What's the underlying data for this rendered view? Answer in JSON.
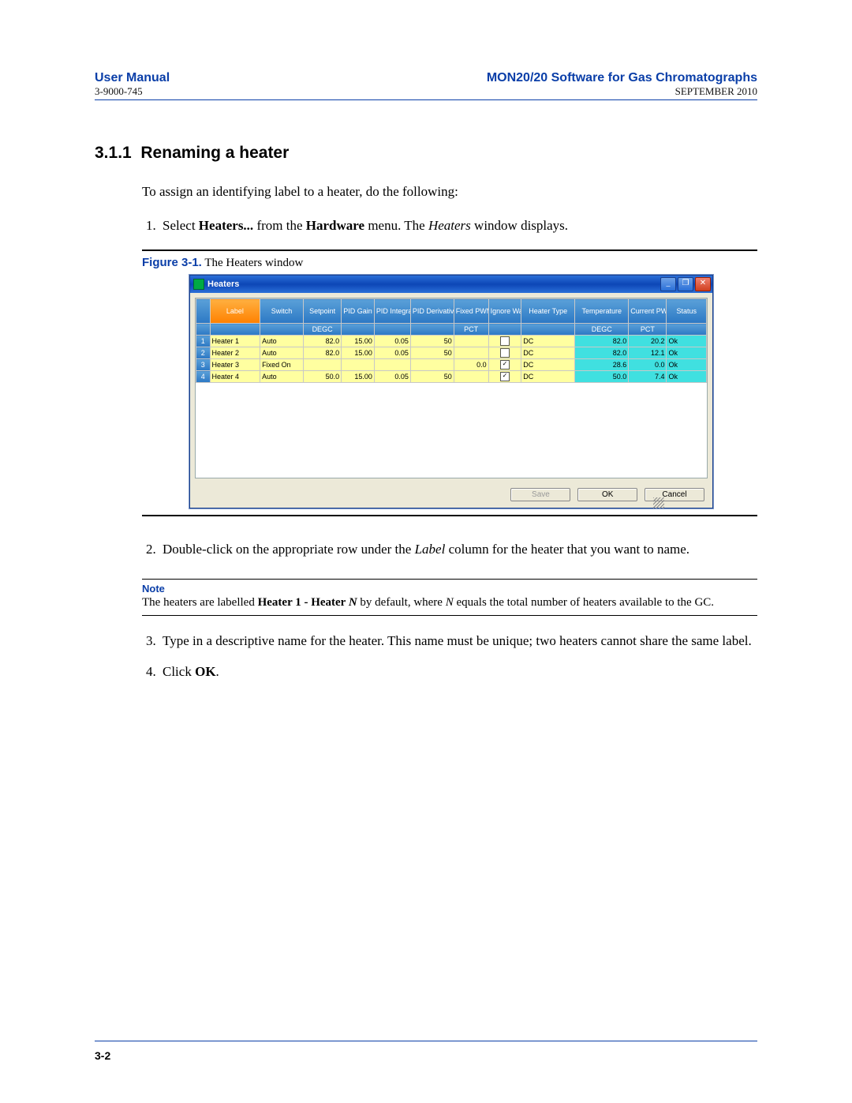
{
  "header": {
    "left_title": "User Manual",
    "left_sub": "3-9000-745",
    "right_title": "MON20/20 Software for Gas Chromatographs",
    "right_sub": "SEPTEMBER 2010"
  },
  "section": {
    "number": "3.1.1",
    "title": "Renaming a heater",
    "intro": "To assign an identifying label to a heater, do the following:",
    "step1_pre": "Select ",
    "step1_b1": "Heaters...",
    "step1_mid": " from the ",
    "step1_b2": "Hardware",
    "step1_post": " menu.  The ",
    "step1_ital": "Heaters",
    "step1_end": " window displays.",
    "step2_pre": "Double-click on the appropriate row under the ",
    "step2_ital": "Label",
    "step2_post": " column for the heater that you want to name.",
    "step3": "Type in a descriptive name for the heater.  This name must be unique; two heaters cannot share the same label.",
    "step4_pre": "Click ",
    "step4_b": "OK",
    "step4_post": "."
  },
  "figure": {
    "label": "Figure 3-1.",
    "caption": "  The Heaters window"
  },
  "window": {
    "title": "Heaters",
    "columns": [
      "",
      "Label",
      "Switch",
      "Setpoint",
      "PID Gain",
      "PID Integral",
      "PID Derivative",
      "Fixed PWM Output",
      "Ignore Warm Start",
      "Heater Type",
      "Temperature",
      "Current PWM",
      "Status"
    ],
    "units": [
      "",
      "",
      "",
      "DEGC",
      "",
      "",
      "",
      "PCT",
      "",
      "",
      "DEGC",
      "PCT",
      ""
    ],
    "rows": [
      {
        "n": "1",
        "label": "Heater 1",
        "switch": "Auto",
        "setpt": "82.0",
        "gain": "15.00",
        "integ": "0.05",
        "deriv": "50",
        "fpwm": "",
        "ign": false,
        "type": "DC",
        "temp": "82.0",
        "cpwm": "20.2",
        "status": "Ok"
      },
      {
        "n": "2",
        "label": "Heater 2",
        "switch": "Auto",
        "setpt": "82.0",
        "gain": "15.00",
        "integ": "0.05",
        "deriv": "50",
        "fpwm": "",
        "ign": false,
        "type": "DC",
        "temp": "82.0",
        "cpwm": "12.1",
        "status": "Ok"
      },
      {
        "n": "3",
        "label": "Heater 3",
        "switch": "Fixed On",
        "setpt": "",
        "gain": "",
        "integ": "",
        "deriv": "",
        "fpwm": "0.0",
        "ign": true,
        "type": "DC",
        "temp": "28.6",
        "cpwm": "0.0",
        "status": "Ok"
      },
      {
        "n": "4",
        "label": "Heater 4",
        "switch": "Auto",
        "setpt": "50.0",
        "gain": "15.00",
        "integ": "0.05",
        "deriv": "50",
        "fpwm": "",
        "ign": true,
        "type": "DC",
        "temp": "50.0",
        "cpwm": "7.4",
        "status": "Ok"
      }
    ],
    "buttons": {
      "save": "Save",
      "ok": "OK",
      "cancel": "Cancel"
    }
  },
  "note": {
    "label": "Note",
    "text_pre": "The heaters are labelled ",
    "text_b": "Heater 1 - Heater ",
    "text_i1": "N",
    "text_mid": " by default, where ",
    "text_i2": "N",
    "text_post": " equals the total number of heaters available to the GC."
  },
  "footer": {
    "page": "3-2"
  }
}
